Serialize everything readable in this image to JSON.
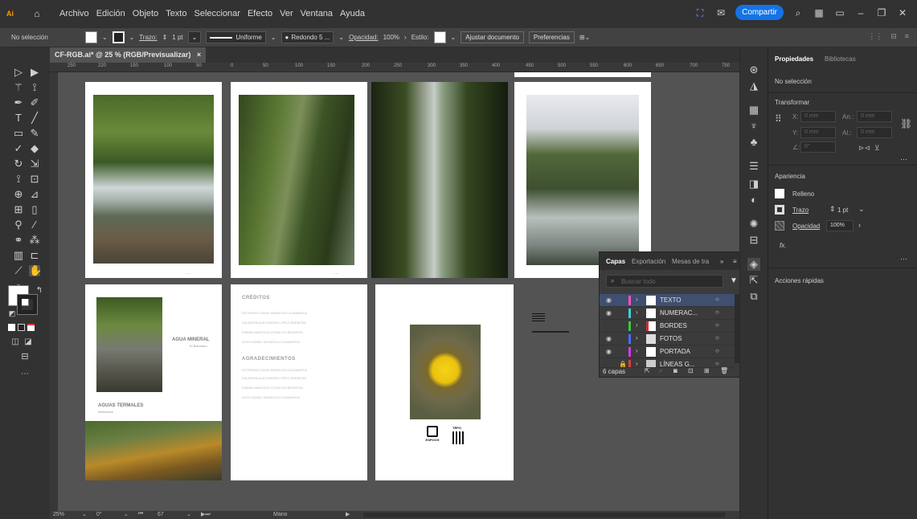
{
  "menubar": {
    "menus": [
      "Archivo",
      "Edición",
      "Objeto",
      "Texto",
      "Seleccionar",
      "Efecto",
      "Ver",
      "Ventana",
      "Ayuda"
    ],
    "share_label": "Compartir"
  },
  "controlbar": {
    "selection_label": "No selección",
    "stroke_label": "Trazo:",
    "stroke_value": "1 pt",
    "profile_label": "Uniforme",
    "brush_label": "Redondo 5 ...",
    "opacity_label": "Opacidad:",
    "opacity_value": "100%",
    "style_label": "Estilo:",
    "fit_doc_label": "Ajustar documento",
    "prefs_label": "Preferencias"
  },
  "document": {
    "tab_title": "CF-RGB.ai* @ 25 % (RGB/Previsualizar)",
    "ruler_labels": [
      "250",
      "220",
      "150",
      "100",
      "50",
      "0",
      "50",
      "100",
      "150",
      "200",
      "250",
      "300",
      "350",
      "400",
      "450",
      "500",
      "550",
      "600",
      "650",
      "700",
      "750"
    ]
  },
  "artboards": {
    "mineral_title": "AGUA MINERAL",
    "mineral_sub": "El Balneario",
    "thermal_title": "AGUAS TERMALES",
    "thermal_sub": "Balnearios",
    "credits_title": "CRÉDITOS",
    "credits_lines": [
      "ESTEFANO DAVID MENDOZA CAJAMARCA",
      "DALMARIA ALEXANDRA LÓPEZ BARBOSA",
      "FABIÁN MARCELA CORALDO BEDERSO",
      "ALEX DANIEL MANDOLA CAJAMARCA"
    ],
    "thanks_title": "AGRADECIMIENTOS",
    "thanks_lines": [
      "ESTEFANO DAVID MENDOZA CAJAMARCA",
      "DALMARIA ALEXANDRA LÓPEZ BARBOSA",
      "FABIÁN MARCELA CORALDO BEDERSO",
      "ALEX DANIEL MANDOLA CAJAMARCA"
    ],
    "logo_text": "ESPOCH",
    "qr_text": "TÉPO"
  },
  "properties": {
    "tab_properties": "Propiedades",
    "tab_libraries": "Bibliotecas",
    "selection": "No selección",
    "transform_label": "Transformar",
    "x_label": "X:",
    "y_label": "Y:",
    "w_label": "An.:",
    "h_label": "Al.:",
    "x_placeholder": "0 mm",
    "y_placeholder": "0 mm",
    "w_placeholder": "0 mm",
    "h_placeholder": "0 mm",
    "angle_label": "∠:",
    "angle_placeholder": "0°",
    "appearance_label": "Apariencia",
    "fill_label": "Relleno",
    "stroke_label": "Trazo",
    "stroke_value": "1 pt",
    "opacity_label": "Opacidad",
    "opacity_value": "100%",
    "fx_label": "fx.",
    "quick_actions_label": "Acciones rápidas"
  },
  "layers_panel": {
    "tab_layers": "Capas",
    "tab_export": "Exportación",
    "tab_artboards": "Mesas de tra",
    "search_placeholder": "Buscar todo",
    "count_label": "6 capas",
    "layers": [
      {
        "name": "TEXTO",
        "color": "#ff4fbf"
      },
      {
        "name": "NUMERAC...",
        "color": "#3ad0e6"
      },
      {
        "name": "BORDES",
        "color": "#3ac93a"
      },
      {
        "name": "FOTOS",
        "color": "#4a6cff"
      },
      {
        "name": "PORTADA",
        "color": "#d43ae6"
      },
      {
        "name": "LÍNEAS G...",
        "color": "#e63a3a"
      }
    ]
  },
  "status": {
    "zoom": "25%",
    "angle": "0°",
    "artboard_num": "67",
    "mode": "Mano"
  }
}
